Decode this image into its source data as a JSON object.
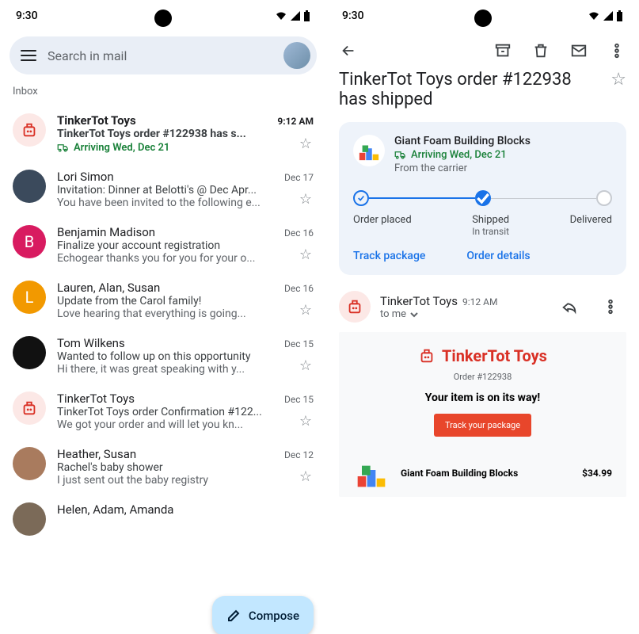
{
  "statusbar": {
    "time": "9:30"
  },
  "left": {
    "search_placeholder": "Search in mail",
    "section_label": "Inbox",
    "compose_label": "Compose",
    "items": [
      {
        "sender": "TinkerTot Toys",
        "date": "9:12 AM",
        "subject": "TinkerTot Toys order #122938 has s...",
        "shipping": "Arriving Wed, Dec 21",
        "bold": true,
        "avatar": "pkg"
      },
      {
        "sender": "Lori Simon",
        "date": "Dec 17",
        "subject": "Invitation: Dinner at Belotti's @ Dec Apr...",
        "snippet": "You have been invited to the following e...",
        "avatar": "photo1"
      },
      {
        "sender": "Benjamin Madison",
        "date": "Dec 16",
        "subject": "Finalize your account registration",
        "snippet": "Echogear thanks you for you for your o...",
        "avatar": "B",
        "color": "#d81b60"
      },
      {
        "sender": "Lauren, Alan, Susan",
        "date": "Dec 16",
        "subject": "Update from the Carol family!",
        "snippet": "Love hearing that everything is going...",
        "avatar": "L",
        "color": "#f29900"
      },
      {
        "sender": "Tom Wilkens",
        "date": "Dec 15",
        "subject": "Wanted to follow up on this opportunity",
        "snippet": "Hi there, it was great speaking with y...",
        "avatar": "photo2"
      },
      {
        "sender": "TinkerTot Toys",
        "date": "Dec 15",
        "subject": "TinkerTot Toys order Confirmation #122...",
        "snippet": "We got your order and will let you kn...",
        "avatar": "pkg"
      },
      {
        "sender": "Heather, Susan",
        "date": "Dec 12",
        "subject": "Rachel's baby shower",
        "snippet": "I just sent out the baby registry",
        "avatar": "photo3"
      },
      {
        "sender": "Helen, Adam, Amanda",
        "date": "",
        "subject": "",
        "snippet": "",
        "avatar": "photo4"
      }
    ]
  },
  "right": {
    "title": "TinkerTot Toys order #122938 has shipped",
    "card": {
      "product": "Giant Foam Building Blocks",
      "arriving": "Arriving Wed, Dec 21",
      "source": "From the carrier",
      "steps": {
        "placed": "Order placed",
        "shipped": "Shipped",
        "shipped_sub": "In transit",
        "delivered": "Delivered"
      },
      "track_link": "Track package",
      "details_link": "Order details"
    },
    "message": {
      "sender": "TinkerTot Toys",
      "time": "9:12 AM",
      "to": "to me"
    },
    "email": {
      "brand": "TinkerTot Toys",
      "order": "Order #122938",
      "onway": "Your item is on its way!",
      "button": "Track your package",
      "item_name": "Giant Foam Building Blocks",
      "item_price": "$34.99"
    }
  }
}
